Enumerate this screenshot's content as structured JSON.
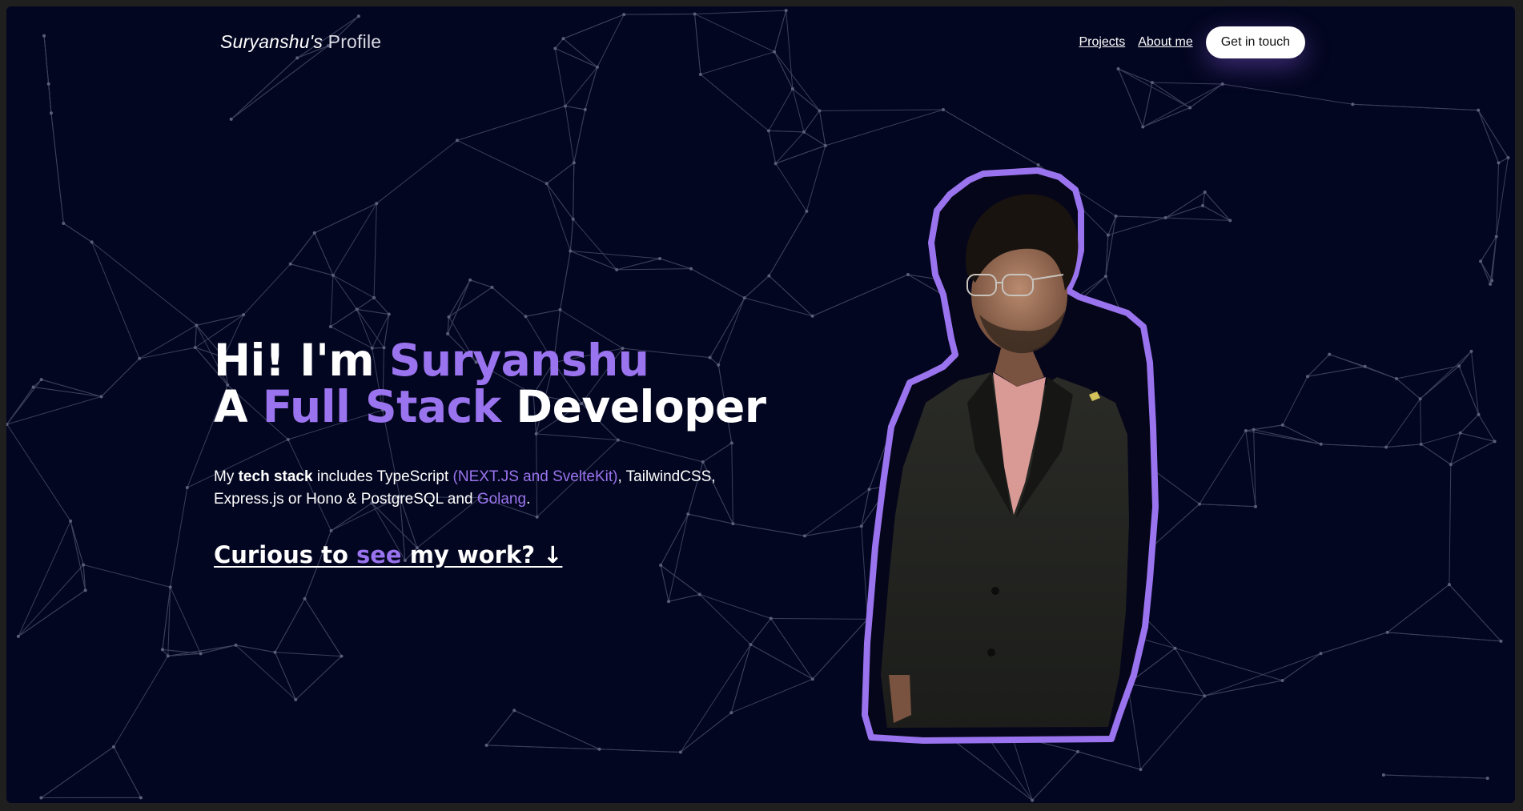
{
  "header": {
    "brand_name": "Suryanshu's",
    "brand_suffix": "Profile",
    "nav": {
      "projects": "Projects",
      "about": "About me",
      "cta": "Get in touch"
    }
  },
  "hero": {
    "line1_prefix": "Hi! I'm ",
    "line1_name": "Suryanshu",
    "line2_prefix": "A ",
    "line2_accent": "Full Stack",
    "line2_suffix": " Developer",
    "intro": {
      "part1": "My ",
      "bold": "tech stack",
      "part2": " includes TypeScript ",
      "accent1": "(NEXT.JS and SvelteKit)",
      "part3": ", TailwindCSS, Express.js or Hono & PostgreSQL and ",
      "accent2": "Golang",
      "part4": "."
    },
    "cta": {
      "prefix": "Curious to ",
      "accent": "see",
      "suffix": " my work? ↓"
    }
  },
  "colors": {
    "background": "#030620",
    "accent": "#9a74ee",
    "text": "#ffffff",
    "button_bg": "#ffffff"
  },
  "icons": [
    "down-arrow-icon"
  ]
}
